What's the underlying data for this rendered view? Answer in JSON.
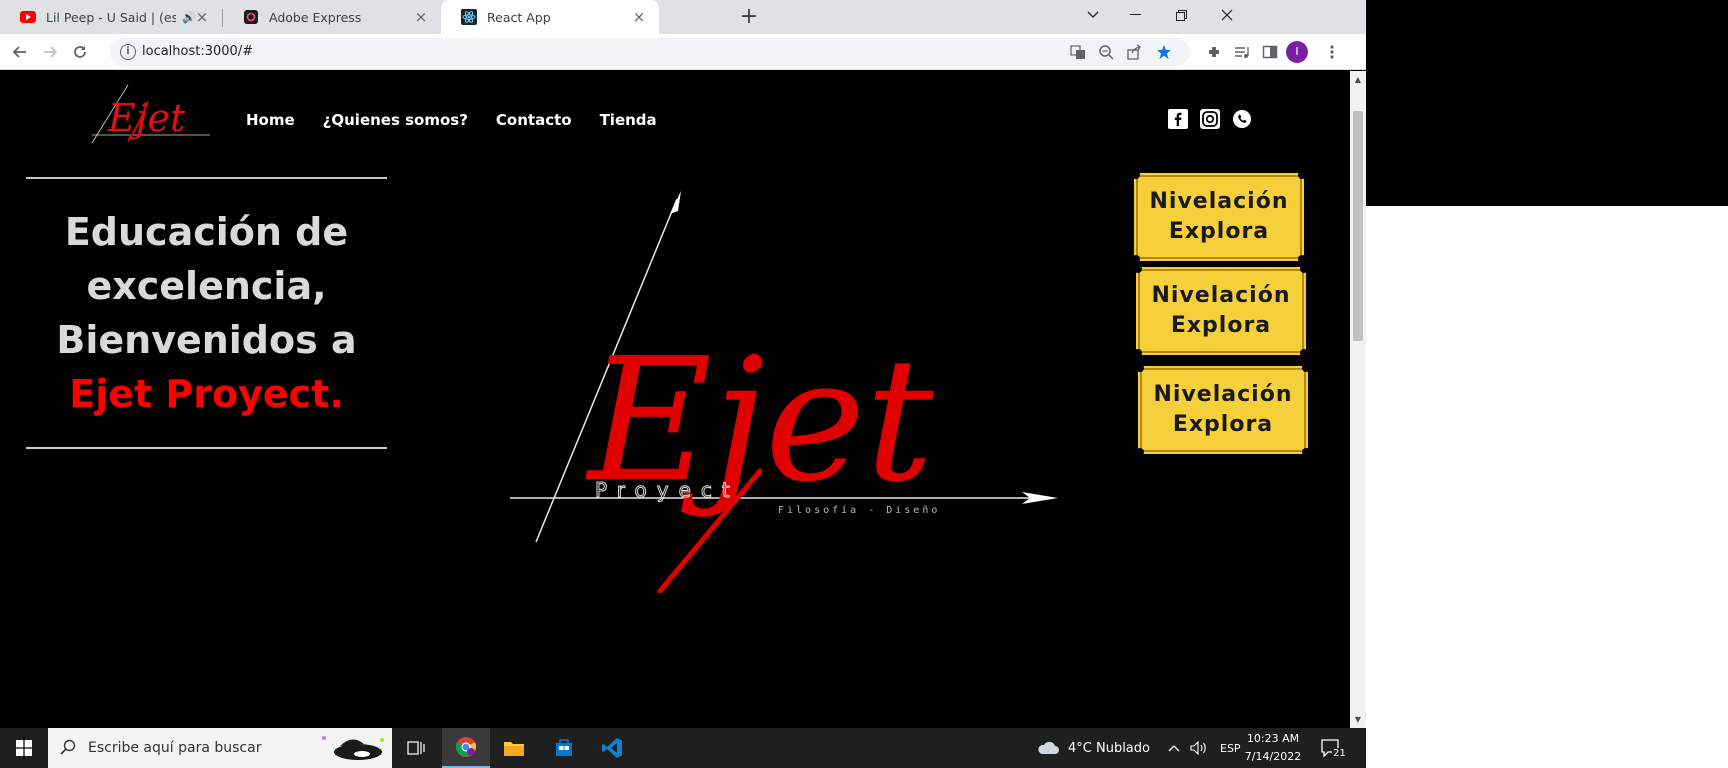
{
  "browser": {
    "tabs": [
      {
        "title": "Lil Peep - U Said | (españo",
        "favicon": "youtube-icon",
        "audio": true
      },
      {
        "title": "Adobe Express",
        "favicon": "adobe-express-icon"
      },
      {
        "title": "React App",
        "favicon": "react-icon",
        "active": true
      }
    ],
    "url": "localhost:3000/#"
  },
  "site": {
    "logo_text": "Ejet",
    "logo_sub": "Proyect",
    "logo_tag": "Filosofía  -  Diseño",
    "nav": [
      "Home",
      "¿Quienes somos?",
      "Contacto",
      "Tienda"
    ],
    "social": [
      "facebook-icon",
      "instagram-icon",
      "whatsapp-icon"
    ],
    "hero": {
      "line1": "Educación de",
      "line2": "excelencia,",
      "line3": "Bienvenidos a",
      "accent": "Ejet Proyect."
    },
    "side_buttons": [
      {
        "line1": "Nivelación",
        "line2": "Explora"
      },
      {
        "line1": "Nivelación",
        "line2": "Explora"
      },
      {
        "line1": "Nivelación",
        "line2": "Explora"
      }
    ],
    "colors": {
      "accent": "#ff0000",
      "button": "#f5d03b",
      "background": "#000000"
    }
  },
  "taskbar": {
    "search_placeholder": "Escribe aquí para buscar",
    "weather": "4°C  Nublado",
    "language": "ESP",
    "time": "10:23 AM",
    "date": "7/14/2022",
    "notifications": "21"
  }
}
